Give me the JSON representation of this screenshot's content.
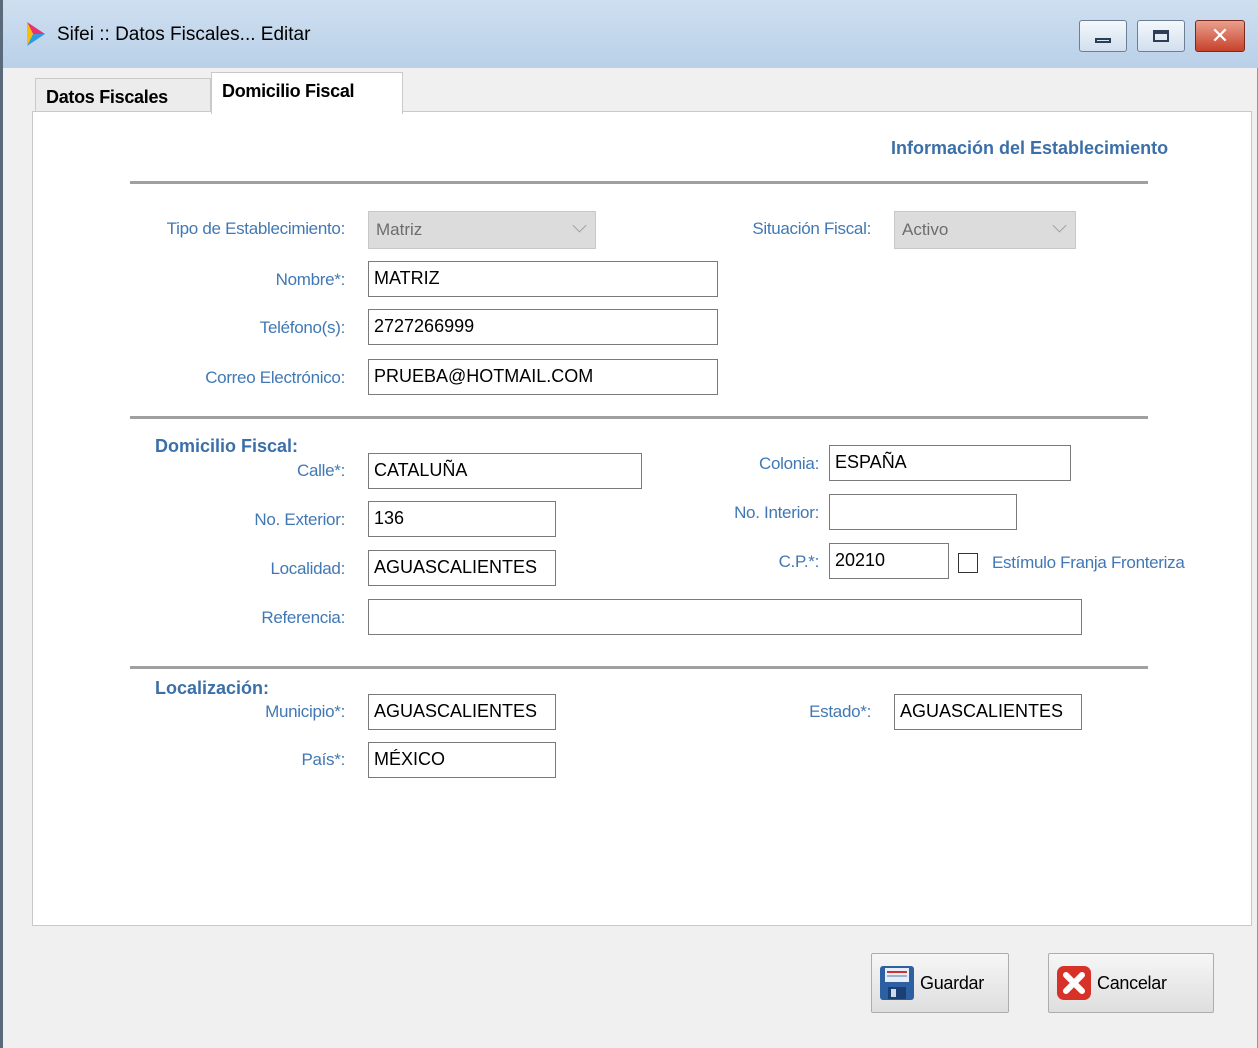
{
  "window": {
    "title": "Sifei :: Datos Fiscales... Editar"
  },
  "tabs": [
    {
      "label": "Datos Fiscales",
      "active": false
    },
    {
      "label": "Domicilio Fiscal",
      "active": true
    }
  ],
  "establishment": {
    "section_title": "Información del Establecimiento",
    "tipo_label": "Tipo de Establecimiento:",
    "tipo_value": "Matriz",
    "situacion_label": "Situación Fiscal:",
    "situacion_value": "Activo",
    "nombre_label": "Nombre*:",
    "nombre_value": "MATRIZ",
    "telefono_label": "Teléfono(s):",
    "telefono_value": "2727266999",
    "correo_label": "Correo Electrónico:",
    "correo_value": "PRUEBA@HOTMAIL.COM"
  },
  "domicilio": {
    "section_title": "Domicilio Fiscal:",
    "calle_label": "Calle*:",
    "calle_value": "CATALUÑA",
    "colonia_label": "Colonia:",
    "colonia_value": "ESPAÑA",
    "exterior_label": "No. Exterior:",
    "exterior_value": "136",
    "interior_label": "No. Interior:",
    "interior_value": "",
    "localidad_label": "Localidad:",
    "localidad_value": "AGUASCALIENTES",
    "cp_label": "C.P.*:",
    "cp_value": "20210",
    "estimulo_label": "Estímulo Franja Fronteriza",
    "estimulo_checked": false,
    "referencia_label": "Referencia:",
    "referencia_value": ""
  },
  "localizacion": {
    "section_title": "Localización:",
    "municipio_label": "Municipio*:",
    "municipio_value": "AGUASCALIENTES",
    "estado_label": "Estado*:",
    "estado_value": "AGUASCALIENTES",
    "pais_label": "País*:",
    "pais_value": "MÉXICO"
  },
  "buttons": {
    "guardar": "Guardar",
    "cancelar": "Cancelar"
  },
  "colors": {
    "label_blue": "#4178b4",
    "section_blue": "#3c6fa8"
  }
}
